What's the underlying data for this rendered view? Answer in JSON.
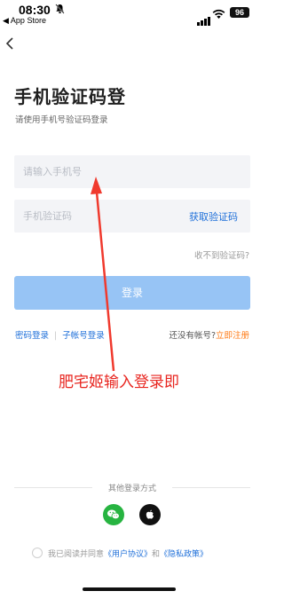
{
  "status_bar": {
    "time": "08:30",
    "back_app": "◀ App Store",
    "battery": "96"
  },
  "header": {
    "title": "手机验证码登",
    "subtitle": "请使用手机号验证码登录"
  },
  "form": {
    "phone_placeholder": "请输入手机号",
    "code_placeholder": "手机验证码",
    "get_code": "获取验证码",
    "no_code": "收不到验证码?",
    "login_button": "登录"
  },
  "links": {
    "password_login": "密码登录",
    "divider": "|",
    "sub_account_login": "子帐号登录",
    "no_account": "还没有帐号?",
    "register": "立即注册"
  },
  "overlay": {
    "text": "肥宅姬输入登录即"
  },
  "other_login": {
    "label": "其他登录方式",
    "icons": [
      "wechat-icon",
      "apple-icon"
    ]
  },
  "agreement": {
    "prefix": "我已阅读并同意",
    "user_agreement": "《用户协议》",
    "and": "和",
    "privacy_policy": "《隐私政策》"
  },
  "colors": {
    "accent_blue": "#1e6fd9",
    "login_button": "#97c4f5",
    "register_orange": "#ff7a14",
    "overlay_red": "#e8251f",
    "wechat_green": "#27b441"
  }
}
